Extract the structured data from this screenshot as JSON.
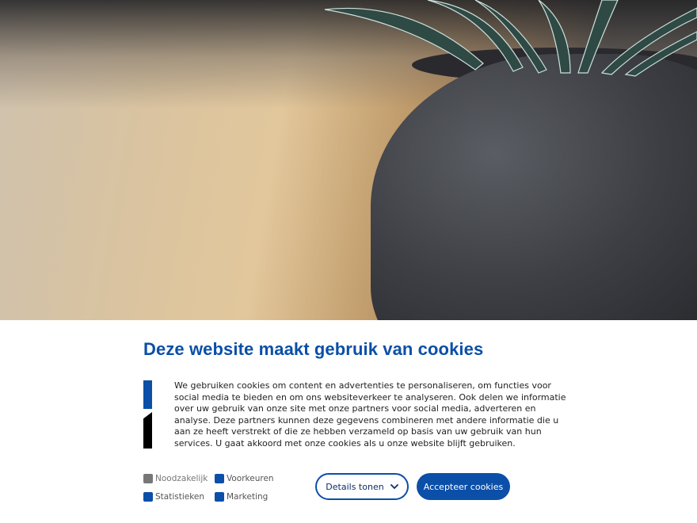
{
  "hero": {
    "alt": "decorative plant image",
    "icon": "plant-image"
  },
  "cookie": {
    "title": "Deze website maakt gebruik van cookies",
    "description": "We gebruiken cookies om content en advertenties te personaliseren, om functies voor social media te bieden en om ons websiteverkeer te analyseren. Ook delen we informatie over uw gebruik van onze site met onze partners voor social media, adverteren en analyse. Deze partners kunnen deze gegevens combineren met andere informatie die u aan ze heeft verstrekt of die ze hebben verzameld op basis van uw gebruik van hun services. U gaat akkoord met onze cookies als u onze website blijft gebruiken.",
    "consents": [
      {
        "label": "Noodzakelijk",
        "checked": true,
        "disabled": true
      },
      {
        "label": "Voorkeuren",
        "checked": true,
        "disabled": false
      },
      {
        "label": "Statistieken",
        "checked": true,
        "disabled": false
      },
      {
        "label": "Marketing",
        "checked": true,
        "disabled": false
      }
    ],
    "details_label": "Details tonen",
    "accept_label": "Accepteer cookies"
  },
  "colors": {
    "accent": "#0b4fa8",
    "disabled": "#777777",
    "text": "#222222"
  }
}
